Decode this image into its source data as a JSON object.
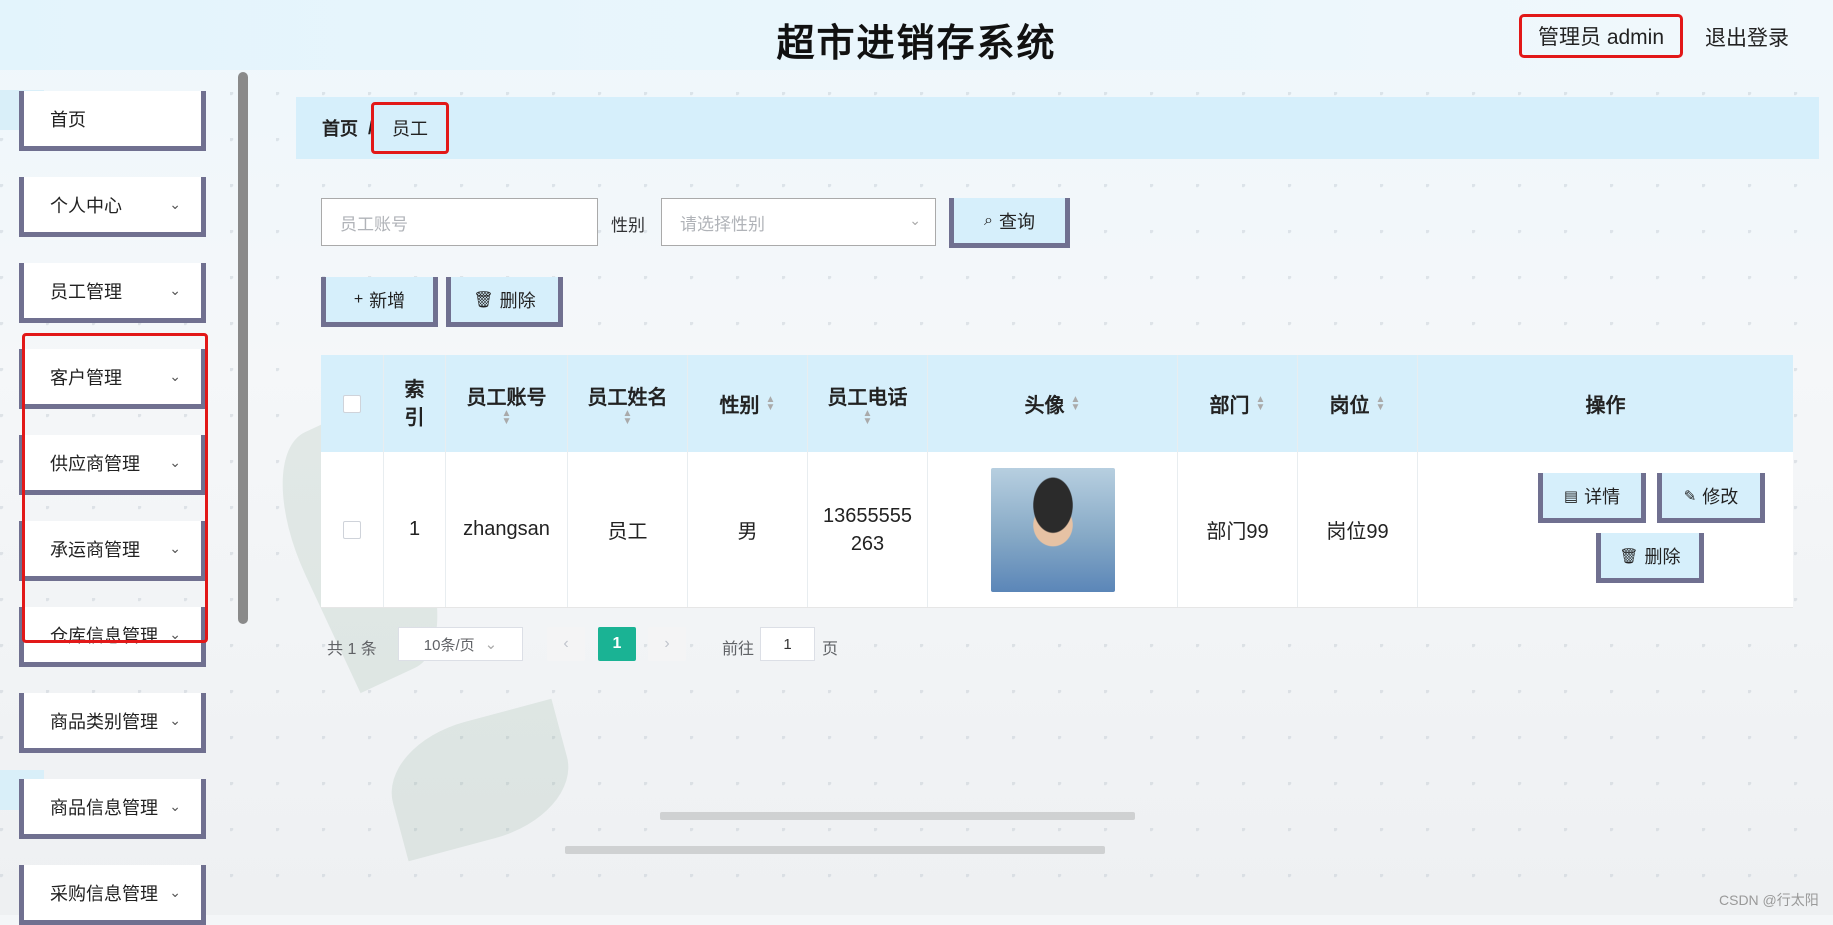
{
  "header": {
    "title": "超市进销存系统",
    "user": "管理员 admin",
    "logout": "退出登录"
  },
  "sidebar": {
    "items": [
      {
        "label": "首页",
        "chevron": false
      },
      {
        "label": "个人中心",
        "chevron": true
      },
      {
        "label": "员工管理",
        "chevron": true
      },
      {
        "label": "客户管理",
        "chevron": true
      },
      {
        "label": "供应商管理",
        "chevron": true
      },
      {
        "label": "承运商管理",
        "chevron": true
      },
      {
        "label": "仓库信息管理",
        "chevron": true
      },
      {
        "label": "商品类别管理",
        "chevron": true
      },
      {
        "label": "商品信息管理",
        "chevron": true
      },
      {
        "label": "采购信息管理",
        "chevron": true
      }
    ],
    "chevron_glyph": "⌄"
  },
  "breadcrumb": {
    "home": "首页",
    "separator": "/",
    "current": "员工"
  },
  "search": {
    "account_placeholder": "员工账号",
    "gender_label": "性别",
    "gender_placeholder": "请选择性别",
    "query_label": "查询"
  },
  "toolbar": {
    "add_label": "新增",
    "delete_label": "删除"
  },
  "table": {
    "headers": {
      "index": "索引",
      "account": "员工账号",
      "name": "员工姓名",
      "gender": "性别",
      "phone": "员工电话",
      "avatar": "头像",
      "department": "部门",
      "post": "岗位",
      "actions": "操作"
    },
    "rows": [
      {
        "index": "1",
        "account": "zhangsan",
        "name": "员工",
        "gender": "男",
        "phone": "13655555263",
        "department": "部门99",
        "post": "岗位99"
      }
    ],
    "action_labels": {
      "detail": "详情",
      "edit": "修改",
      "delete": "删除"
    }
  },
  "pagination": {
    "total": "共 1 条",
    "page_size": "10条/页",
    "current_page": "1",
    "goto_prefix": "前往",
    "goto_value": "1",
    "goto_suffix": "页"
  },
  "watermark": "CSDN @行太阳",
  "colors": {
    "accent": "#1ab394",
    "highlight": "#e21818",
    "header_bg": "#d6effb",
    "border": "#707090"
  },
  "icons": {
    "search": "search-icon",
    "add": "plus-icon",
    "delete": "trash-icon",
    "detail": "document-icon",
    "edit": "pencil-icon"
  }
}
